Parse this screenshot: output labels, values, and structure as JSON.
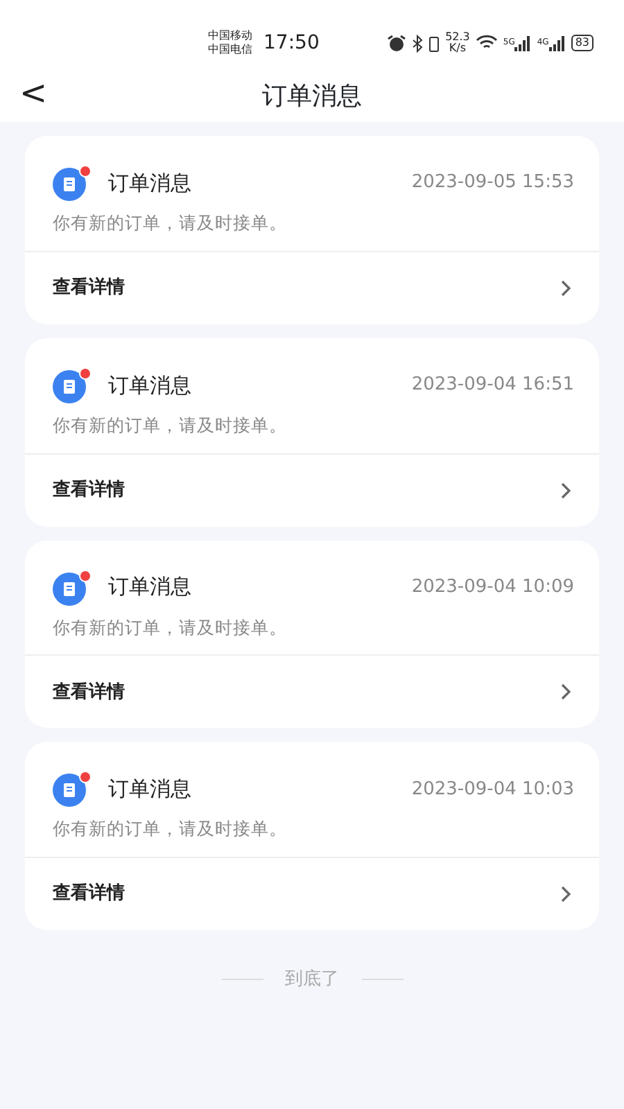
{
  "status_bar": {
    "carriers": [
      "中国移动",
      "中国电信"
    ],
    "time": "17:50",
    "speed": [
      "52.3",
      "K/s"
    ],
    "networks": [
      "5G",
      "4G"
    ],
    "battery": "83"
  },
  "header": {
    "back": "<",
    "title": "订单消息"
  },
  "messages": [
    {
      "title": "订单消息",
      "time": "2023-09-05 15:53",
      "body": "你有新的订单，请及时接单。",
      "action": "查看详情",
      "unread": true
    },
    {
      "title": "订单消息",
      "time": "2023-09-04 16:51",
      "body": "你有新的订单，请及时接单。",
      "action": "查看详情",
      "unread": true
    },
    {
      "title": "订单消息",
      "time": "2023-09-04 10:09",
      "body": "你有新的订单，请及时接单。",
      "action": "查看详情",
      "unread": true
    },
    {
      "title": "订单消息",
      "time": "2023-09-04 10:03",
      "body": "你有新的订单，请及时接单。",
      "action": "查看详情",
      "unread": true
    }
  ],
  "footer": "到底了"
}
